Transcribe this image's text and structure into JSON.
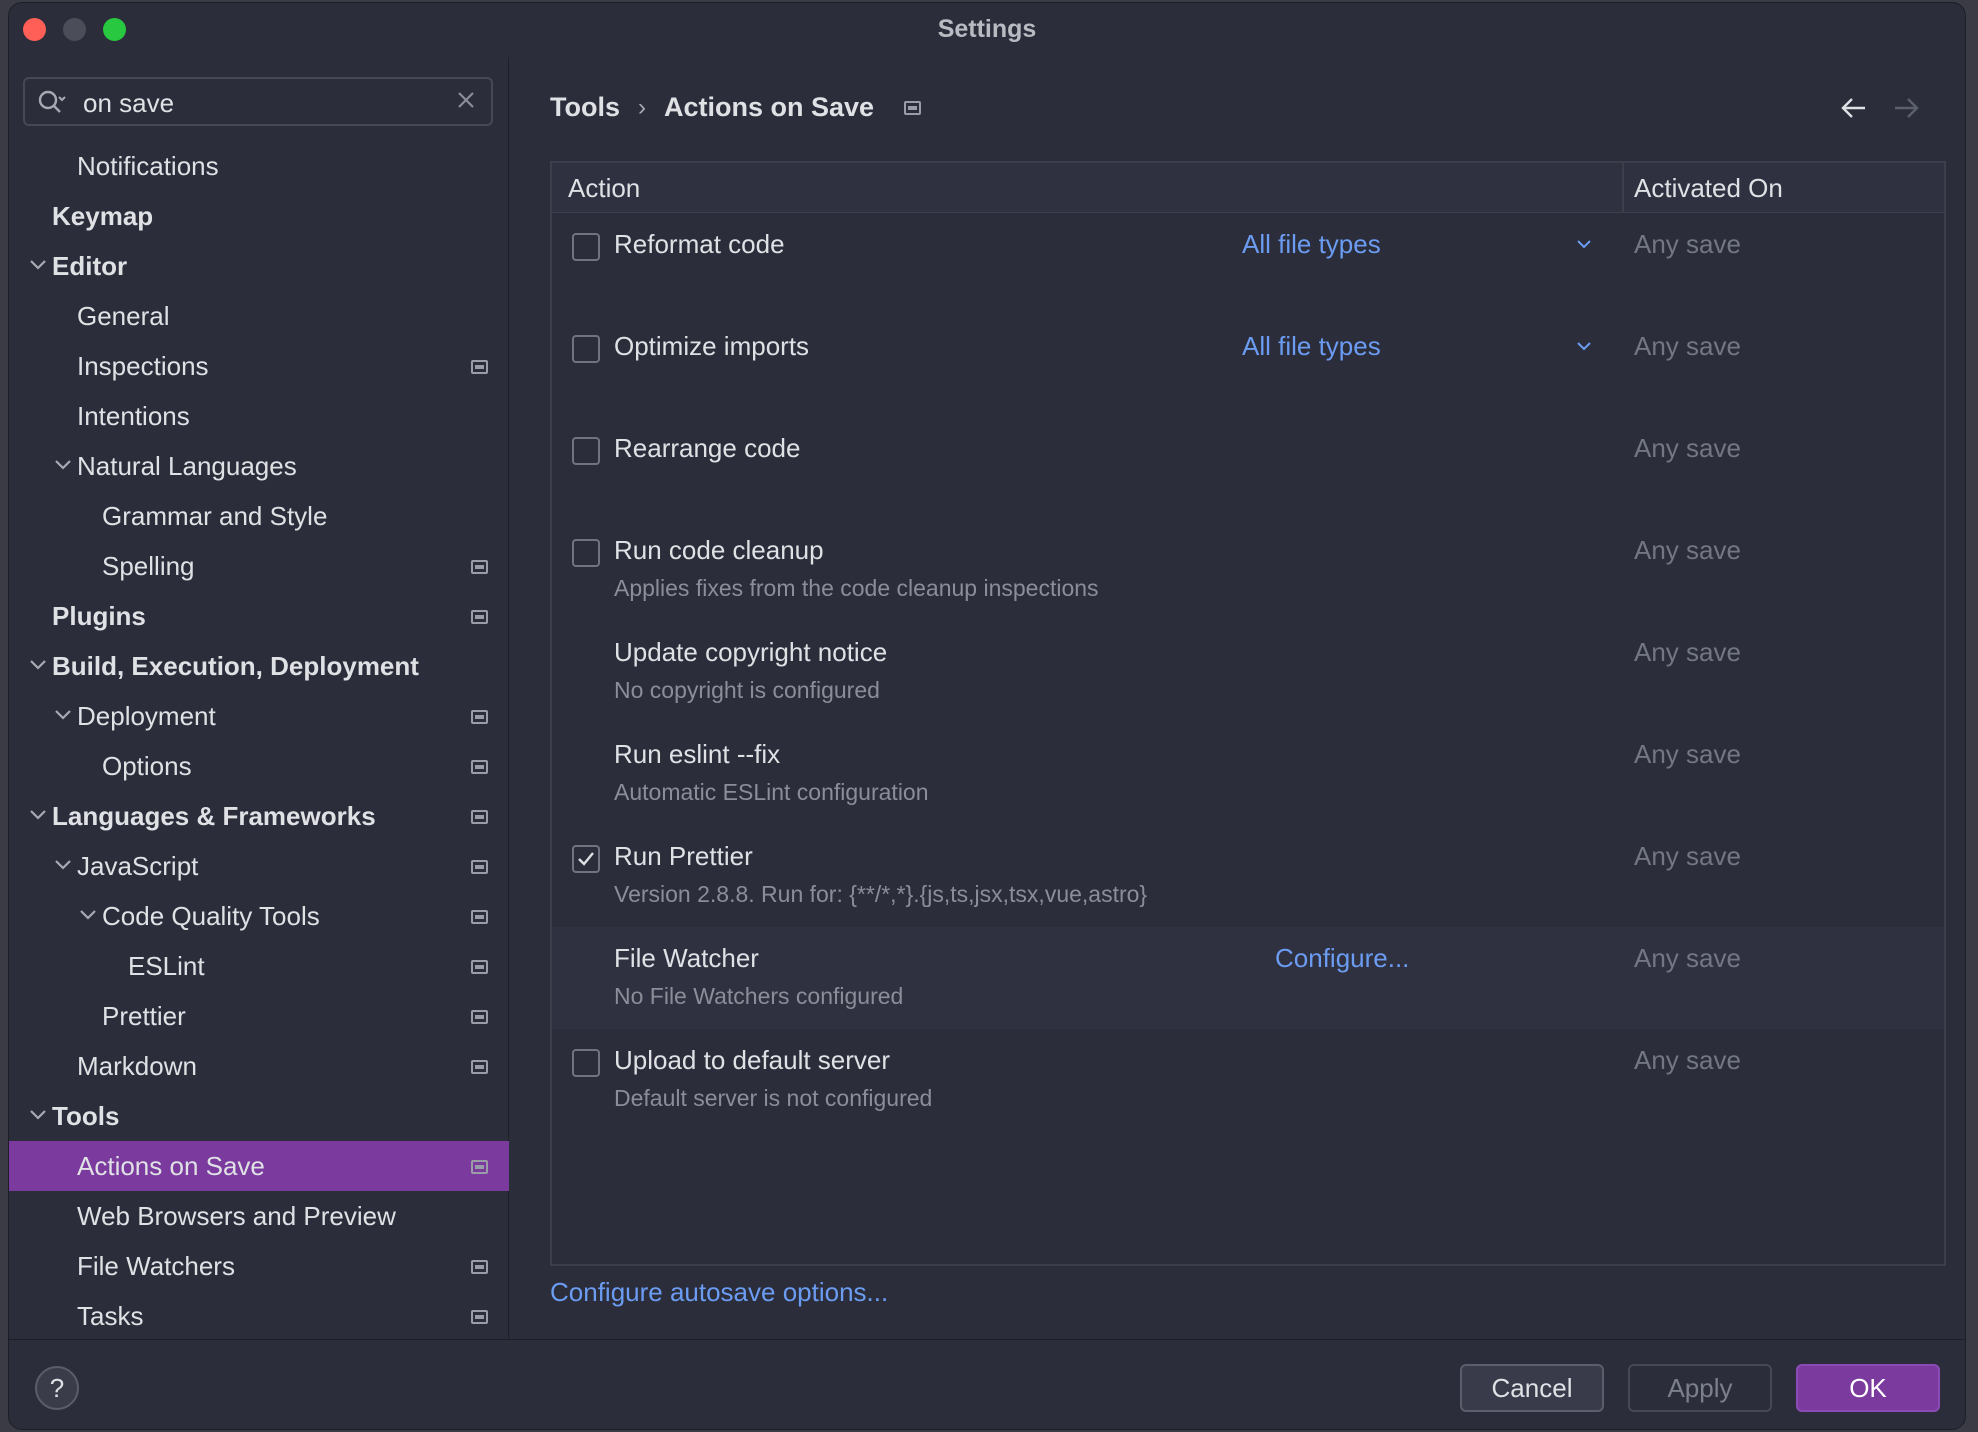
{
  "window": {
    "title": "Settings"
  },
  "search": {
    "value": "on save"
  },
  "sidebar": {
    "items": [
      {
        "label": "Notifications"
      },
      {
        "label": "Keymap"
      },
      {
        "label": "Editor"
      },
      {
        "label": "General"
      },
      {
        "label": "Inspections"
      },
      {
        "label": "Intentions"
      },
      {
        "label": "Natural Languages"
      },
      {
        "label": "Grammar and Style"
      },
      {
        "label": "Spelling"
      },
      {
        "label": "Plugins"
      },
      {
        "label": "Build, Execution, Deployment"
      },
      {
        "label": "Deployment"
      },
      {
        "label": "Options"
      },
      {
        "label": "Languages & Frameworks"
      },
      {
        "label": "JavaScript"
      },
      {
        "label": "Code Quality Tools"
      },
      {
        "label": "ESLint"
      },
      {
        "label": "Prettier"
      },
      {
        "label": "Markdown"
      },
      {
        "label": "Tools"
      },
      {
        "label": "Actions on Save"
      },
      {
        "label": "Web Browsers and Preview"
      },
      {
        "label": "File Watchers"
      },
      {
        "label": "Tasks"
      }
    ]
  },
  "breadcrumb": {
    "parent": "Tools",
    "separator": "›",
    "current": "Actions on Save"
  },
  "table": {
    "columns": {
      "action": "Action",
      "activated_on": "Activated On"
    },
    "rows": [
      {
        "title": "Reformat code",
        "subtitle": "",
        "link": "All file types",
        "activated": "Any save",
        "checked": false
      },
      {
        "title": "Optimize imports",
        "subtitle": "",
        "link": "All file types",
        "activated": "Any save",
        "checked": false
      },
      {
        "title": "Rearrange code",
        "subtitle": "",
        "link": "",
        "activated": "Any save",
        "checked": false
      },
      {
        "title": "Run code cleanup",
        "subtitle": "Applies fixes from the code cleanup inspections",
        "link": "",
        "activated": "Any save",
        "checked": false
      },
      {
        "title": "Update copyright notice",
        "subtitle": "No copyright is configured",
        "link": "",
        "activated": "Any save",
        "checked": null
      },
      {
        "title": "Run eslint --fix",
        "subtitle": "Automatic ESLint configuration",
        "link": "",
        "activated": "Any save",
        "checked": null
      },
      {
        "title": "Run Prettier",
        "subtitle": "Version 2.8.8. Run for: {**/*,*}.{js,ts,jsx,tsx,vue,astro}",
        "link": "",
        "activated": "Any save",
        "checked": true
      },
      {
        "title": "File Watcher",
        "subtitle": "No File Watchers configured",
        "link": "Configure...",
        "activated": "Any save",
        "checked": null
      },
      {
        "title": "Upload to default server",
        "subtitle": "Default server is not configured",
        "link": "",
        "activated": "Any save",
        "checked": false
      }
    ]
  },
  "autosave_link": "Configure autosave options...",
  "footer": {
    "help": "?",
    "cancel": "Cancel",
    "apply": "Apply",
    "ok": "OK"
  },
  "colors": {
    "accent": "#7b3a9e",
    "link": "#6b9cf2",
    "background": "#2b2d3a"
  },
  "icons": [
    "search-icon",
    "clear-icon",
    "chevron-down-icon",
    "page-settings-icon",
    "back-arrow-icon",
    "forward-arrow-icon",
    "checkmark-icon",
    "help-icon"
  ]
}
